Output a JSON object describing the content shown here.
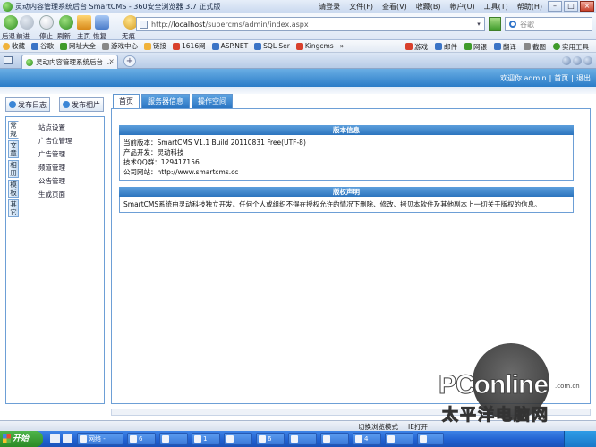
{
  "browser": {
    "title": "灵动内容管理系统后台 SmartCMS - 360安全浏览器 3.7 正式版",
    "menus": [
      "请登录",
      "文件(F)",
      "查看(V)",
      "收藏(B)",
      "帐户(U)",
      "工具(T)",
      "帮助(H)"
    ],
    "nav_labels": [
      "后退",
      "前进",
      "停止",
      "刷新",
      "主页",
      "恢复",
      "无痕"
    ],
    "address": {
      "scheme": "http://",
      "host": "localhost",
      "path": "/supercms/admin/index.aspx"
    },
    "search_placeholder": "谷歌",
    "favorites": [
      "收藏",
      "谷歌",
      "网址大全",
      "游戏中心",
      "链接",
      "1616网",
      "ASP.NET",
      "SQL Ser",
      "Kingcms",
      "»"
    ],
    "favorites_right": [
      "游戏",
      "邮件",
      "网银",
      "翻译",
      "截图",
      "实用工具"
    ],
    "tab_title": "灵动内容管理系统后台 ...",
    "tab_close": "×",
    "new_tab": "+",
    "status": {
      "mode": "切换浏览模式",
      "mode2": "IE打开"
    }
  },
  "app": {
    "welcome": {
      "text": "欢迎你 admin",
      "home": "首页",
      "exit": "退出"
    },
    "publish_log": "发布日志",
    "publish_album": "发布相片",
    "vertical_tabs": [
      "常规",
      "文章",
      "相册",
      "模板",
      "其它"
    ],
    "menu_items": [
      "站点设置",
      "广告位管理",
      "广告管理",
      "频道管理",
      "公告管理",
      "生成页面"
    ],
    "content_tabs": [
      "首页",
      "服务器信息",
      "操作空间"
    ],
    "version_section": {
      "title": "版本信息",
      "rows": [
        "当前版本：SmartCMS V1.1 Build 20110831 Free(UTF-8)",
        "产品开发：灵动科技",
        "技术QQ群：129417156",
        "公司网站：http://www.smartcms.cc"
      ]
    },
    "copyright_section": {
      "title": "版权声明",
      "text": "SmartCMS系统由灵动科技独立开发。任何个人或组织不得在授权允许的情况下删除、修改、拷贝本软件及其他副本上一切关于版权的信息。"
    }
  },
  "taskbar": {
    "start": "开始",
    "tasks": [
      "网络 -",
      "6",
      "",
      "",
      "1",
      "",
      "6",
      "",
      "",
      "4",
      "",
      "",
      "",
      ""
    ]
  },
  "watermark": {
    "brand": "PConline",
    "domain": ".com.cn",
    "cn": "太平洋电脑网"
  }
}
